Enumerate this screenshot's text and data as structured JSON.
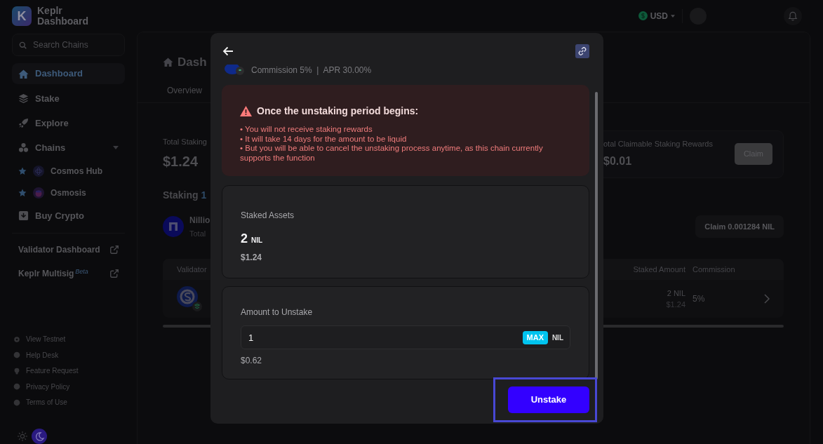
{
  "sidebar": {
    "logo_mark": "K",
    "title": "Keplr Dashboard",
    "search": {
      "placeholder": "Search Chains"
    },
    "nav": [
      {
        "label": "Dashboard",
        "selected": true
      },
      {
        "label": "Stake",
        "selected": false
      },
      {
        "label": "Explore",
        "selected": false
      },
      {
        "label": "Chains",
        "selected": false,
        "expanded": true,
        "children": [
          {
            "label": "Cosmos Hub",
            "favorite": true
          },
          {
            "label": "Osmosis",
            "favorite": true
          }
        ]
      },
      {
        "label": "Buy Crypto",
        "selected": false
      }
    ],
    "external_links": [
      {
        "label": "Validator Dashboard"
      },
      {
        "label": "Keplr Multisig",
        "badge": "Beta"
      }
    ],
    "footer_links": [
      {
        "label": "View Testnet"
      },
      {
        "label": "Help Desk"
      },
      {
        "label": "Feature Request"
      },
      {
        "label": "Privacy Policy"
      },
      {
        "label": "Terms of Use"
      }
    ],
    "theme": {
      "dark": true
    }
  },
  "topbar": {
    "currency": "USD"
  },
  "dashboard": {
    "title": "Dash",
    "tabs": [
      {
        "label": "Overview",
        "selected": true
      }
    ],
    "total_staking": {
      "label": "Total Staking",
      "value": "$1.24"
    },
    "claimable": {
      "label": "otal Claimable Staking Rewards",
      "value": "$0.01",
      "button": "Claim"
    },
    "staking": {
      "title": "Staking",
      "count": "1",
      "chain": {
        "name": "Nillio",
        "sub": "Total",
        "claim_button": "Claim 0.001284 NIL"
      }
    },
    "table": {
      "columns": [
        "Validator",
        "Staked Amount",
        "Commission"
      ],
      "rows": [
        {
          "amount": "2 NIL",
          "value": "$1.24",
          "commission": "5%"
        }
      ]
    }
  },
  "modal": {
    "validator_info": "Commission 5%  |  APR 30.00%",
    "warning": {
      "title": "Once the unstaking period begins:",
      "items": [
        "• You will not receive staking rewards",
        "• It will take 14 days for the amount to be liquid",
        "• But you will be able to cancel the unstaking process anytime, as this chain currently supports the function"
      ]
    },
    "staked": {
      "label": "Staked Assets",
      "amount": "2",
      "unit": "NIL",
      "value": "$1.24"
    },
    "unstake": {
      "label": "Amount to Unstake",
      "value": "1",
      "max_button": "MAX",
      "unit": "NIL",
      "fiat": "$0.62"
    },
    "submit": {
      "label": "Unstake",
      "highlighted": true
    }
  }
}
